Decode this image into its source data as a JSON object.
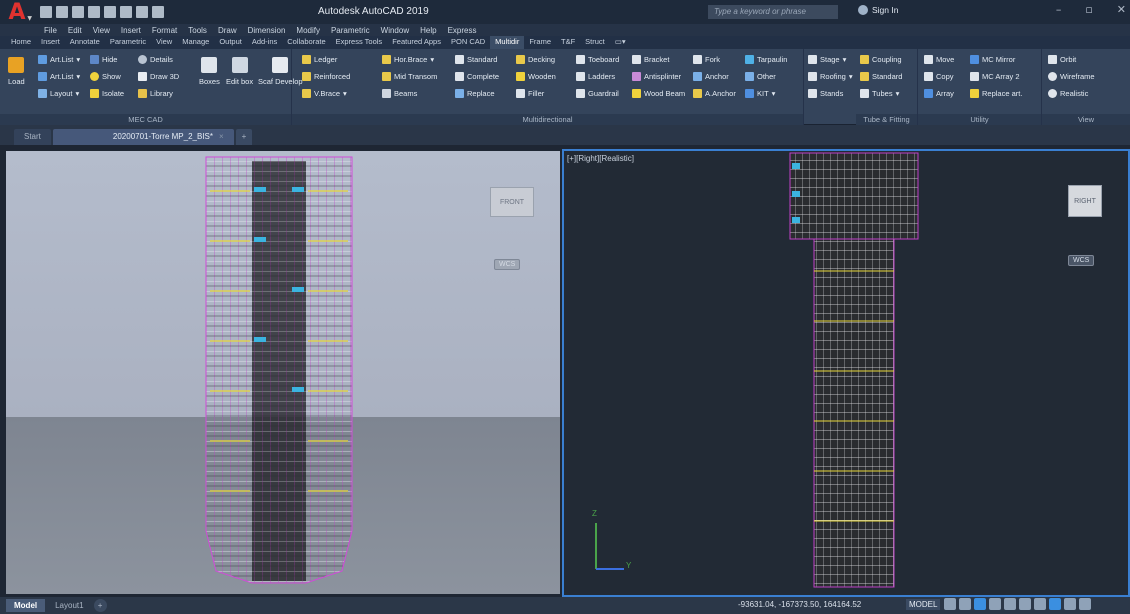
{
  "app": {
    "title": "Autodesk AutoCAD 2019",
    "search_placeholder": "Type a keyword or phrase",
    "sign_in": "Sign In",
    "logo": "A"
  },
  "menu": [
    "File",
    "Edit",
    "View",
    "Insert",
    "Format",
    "Tools",
    "Draw",
    "Dimension",
    "Modify",
    "Parametric",
    "Window",
    "Help",
    "Express"
  ],
  "ribbon_tabs": [
    "Home",
    "Insert",
    "Annotate",
    "Parametric",
    "View",
    "Manage",
    "Output",
    "Add-ins",
    "Collaborate",
    "Express Tools",
    "Featured Apps",
    "PON CAD",
    "Multidir",
    "Frame",
    "T&F",
    "Struct"
  ],
  "ribbon_active_tab": "Multidir",
  "panels": {
    "mec": {
      "title": "MEC CAD",
      "load": "Load",
      "artlist1": "Art.List",
      "artlist2": "Art.List",
      "layout": "Layout",
      "hide": "Hide",
      "show": "Show",
      "isolate": "Isolate",
      "details": "Details",
      "draw3d": "Draw 3D",
      "library": "Library",
      "boxes": "Boxes",
      "editbox": "Edit box",
      "scafdevelop": "Scaf Develop"
    },
    "multi": {
      "title": "Multidirectional",
      "ledger": "Ledger",
      "reinforced": "Reinforced",
      "vbrace": "V.Brace",
      "horbrace": "Hor.Brace",
      "midtransom": "Mid Transom",
      "beams": "Beams",
      "standard": "Standard",
      "complete": "Complete",
      "replace": "Replace",
      "decking": "Decking",
      "wooden": "Wooden",
      "filler": "Filler",
      "toeboard": "Toeboard",
      "ladders": "Ladders",
      "guardrail": "Guardrail",
      "bracket": "Bracket",
      "antisplinter": "Antisplinter",
      "woodbeam": "Wood Beam",
      "fork": "Fork",
      "anchor": "Anchor",
      "aanchor": "A.Anchor",
      "tarpaulin": "Tarpaulin",
      "other": "Other",
      "kit": "KIT",
      "stage": "Stage",
      "roofing": "Roofing",
      "stands": "Stands"
    },
    "tube": {
      "title": "Tube & Fitting",
      "coupling": "Coupling",
      "standard": "Standard",
      "tubes": "Tubes"
    },
    "utility": {
      "title": "Utility",
      "move": "Move",
      "copy": "Copy",
      "array": "Array",
      "mcmirror": "MC Mirror",
      "mcarray2": "MC Array 2",
      "replaceart": "Replace art."
    },
    "view": {
      "title": "View",
      "orbit": "Orbit",
      "wireframe": "Wireframe",
      "realistic": "Realistic"
    }
  },
  "doc_tabs": {
    "start": "Start",
    "file": "20200701-Torre MP_2_BIS*",
    "close": "×",
    "add": "+"
  },
  "viewports": {
    "left": {
      "cube_label": "FRONT",
      "wcs": "WCS"
    },
    "right": {
      "label": "[+][Right][Realistic]",
      "cube_label": "RIGHT",
      "wcs": "WCS",
      "axis_z": "Z",
      "axis_y": "Y"
    }
  },
  "layout_tabs": {
    "model": "Model",
    "layout1": "Layout1",
    "add": "+"
  },
  "status": {
    "coords": "-93631.04, -167373.50, 164164.52",
    "model": "MODEL"
  }
}
